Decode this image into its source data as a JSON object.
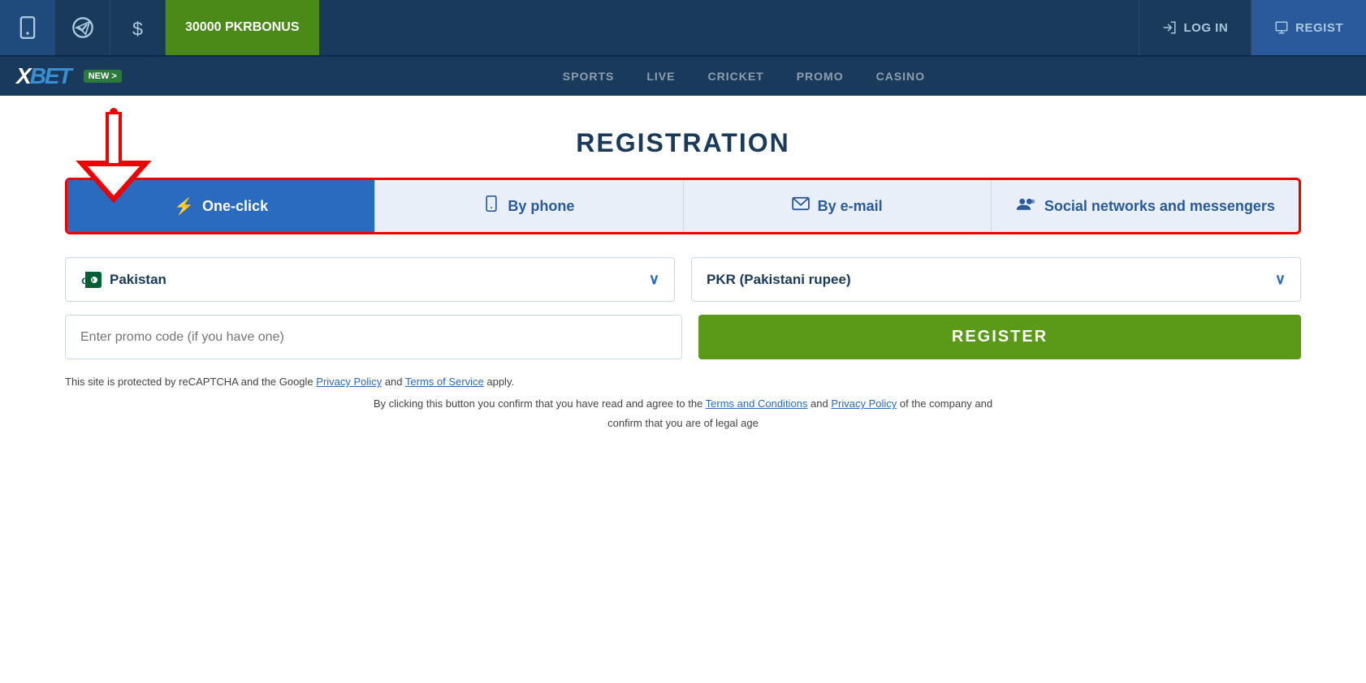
{
  "topbar": {
    "bonus_amount": "30000 PKR",
    "bonus_label": "BONUS",
    "login_label": "LOG IN",
    "register_label": "REGIST"
  },
  "navbar": {
    "logo": "BET",
    "new_badge": "NEW >",
    "items": [
      "SPORTS",
      "LIVE",
      "CRICKET",
      "PROMO",
      "CASINO"
    ]
  },
  "registration": {
    "title": "REGISTRATION",
    "tabs": [
      {
        "id": "one-click",
        "label": "One-click",
        "icon": "⚡",
        "active": true
      },
      {
        "id": "by-phone",
        "label": "By phone",
        "icon": "📱",
        "active": false
      },
      {
        "id": "by-email",
        "label": "By e-mail",
        "icon": "✉",
        "active": false
      },
      {
        "id": "social",
        "label": "Social networks and messengers",
        "icon": "👥",
        "active": false
      }
    ],
    "country_label": "Pakistan",
    "currency_label": "PKR (Pakistani rupee)",
    "promo_placeholder": "Enter promo code (if you have one)",
    "register_button": "REGISTER",
    "recaptcha_text": "This site is protected by reCAPTCHA and the Google",
    "privacy_policy_link": "Privacy Policy",
    "and_text": "and",
    "terms_link": "Terms of Service",
    "apply_text": "apply.",
    "agreement_text1": "By clicking this button you confirm that you have read and agree to the",
    "terms_conditions_link": "Terms and Conditions",
    "and2_text": "and",
    "privacy_policy2_link": "Privacy Policy",
    "agreement_text2": "of the company and",
    "confirm_text": "confirm that you are of legal age"
  }
}
